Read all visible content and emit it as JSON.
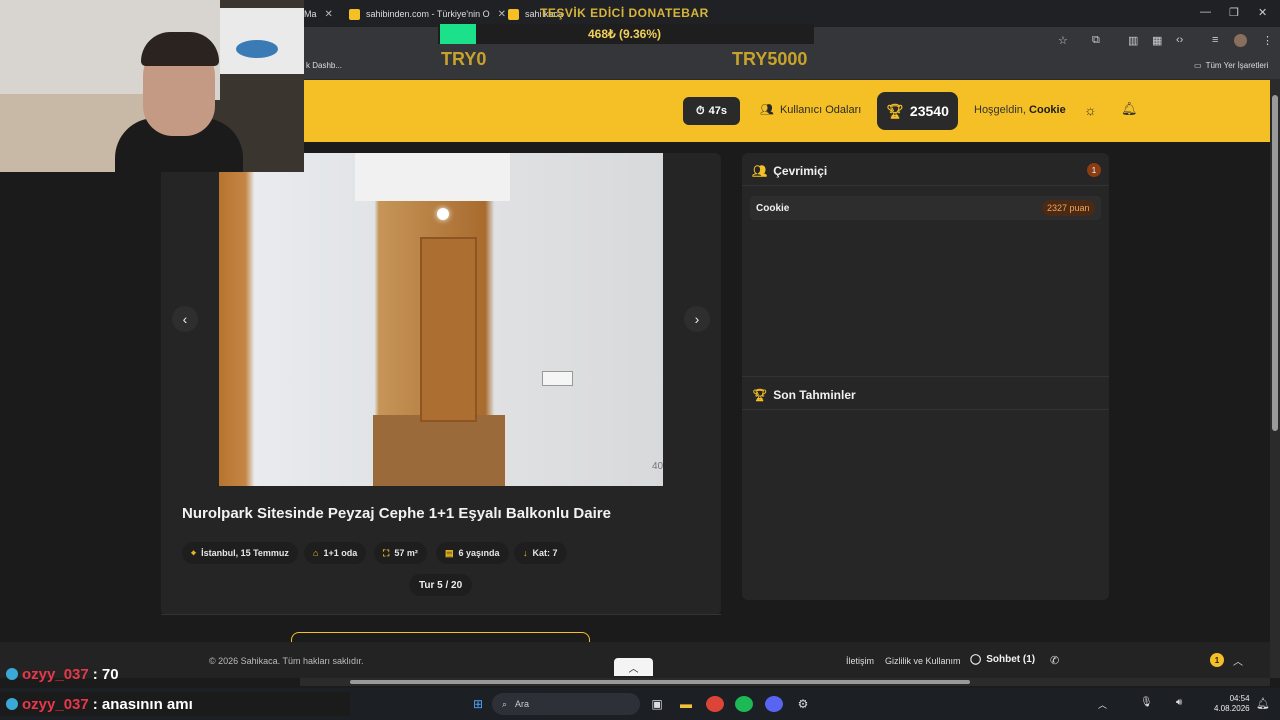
{
  "browser": {
    "tabs": [
      {
        "label": "Ma",
        "favicon_color": "#5c6bc0"
      },
      {
        "label": "sahibinden.com - Türkiye'nin O",
        "favicon_color": "#f5c026"
      },
      {
        "label": "sahi kaca",
        "favicon_color": "#f5c026"
      }
    ],
    "bookmark_left": "k Dashb...",
    "bookmark_right": "Tüm Yer İşaretleri"
  },
  "donation": {
    "title": "TEŞVİK EDİCİ DONATEBAR",
    "amount": "468₺ (9.36%)",
    "progress_percent": 9.36,
    "min_label": "TRY0",
    "max_label": "TRY5000",
    "fill_color": "#1be28a"
  },
  "header": {
    "timer": "47s",
    "rooms_label": "Kullanıcı Odaları",
    "score": "23540",
    "greeting": "Hoşgeldin,",
    "username": "Cookie",
    "accent_color": "#f5c026"
  },
  "listing": {
    "photo_counter": "40",
    "title": "Nurolpark Sitesinde Peyzaj Cephe 1+1 Eşyalı Balkonlu Daire",
    "chips": [
      {
        "icon": "location-icon",
        "label": "İstanbul, 15 Temmuz"
      },
      {
        "icon": "home-icon",
        "label": "1+1 oda"
      },
      {
        "icon": "area-icon",
        "label": "57 m²"
      },
      {
        "icon": "building-icon",
        "label": "6 yaşında"
      },
      {
        "icon": "floor-icon",
        "label": "Kat: 7"
      }
    ],
    "round_label": "Tur",
    "round_value": "5 / 20"
  },
  "online": {
    "title": "Çevrimiçi",
    "count": "1",
    "users": [
      {
        "name": "Cookie",
        "points": "2327 puan"
      }
    ]
  },
  "recent_guesses": {
    "title": "Son Tahminler"
  },
  "footer": {
    "copyright": "© 2026 Sahikaca. Tüm hakları saklıdır.",
    "contact": "İletişim",
    "privacy": "Gizlilik ve Kullanım",
    "chat": "Sohbet (1)",
    "notif_count": "1"
  },
  "stream_chat": [
    {
      "user": "ozyy_037",
      "message": ": 70"
    },
    {
      "user": "ozyy_037",
      "message": ": anasının amı"
    }
  ],
  "taskbar": {
    "search_placeholder": "Ara",
    "time": "04:54",
    "date": "4.08.2026"
  }
}
